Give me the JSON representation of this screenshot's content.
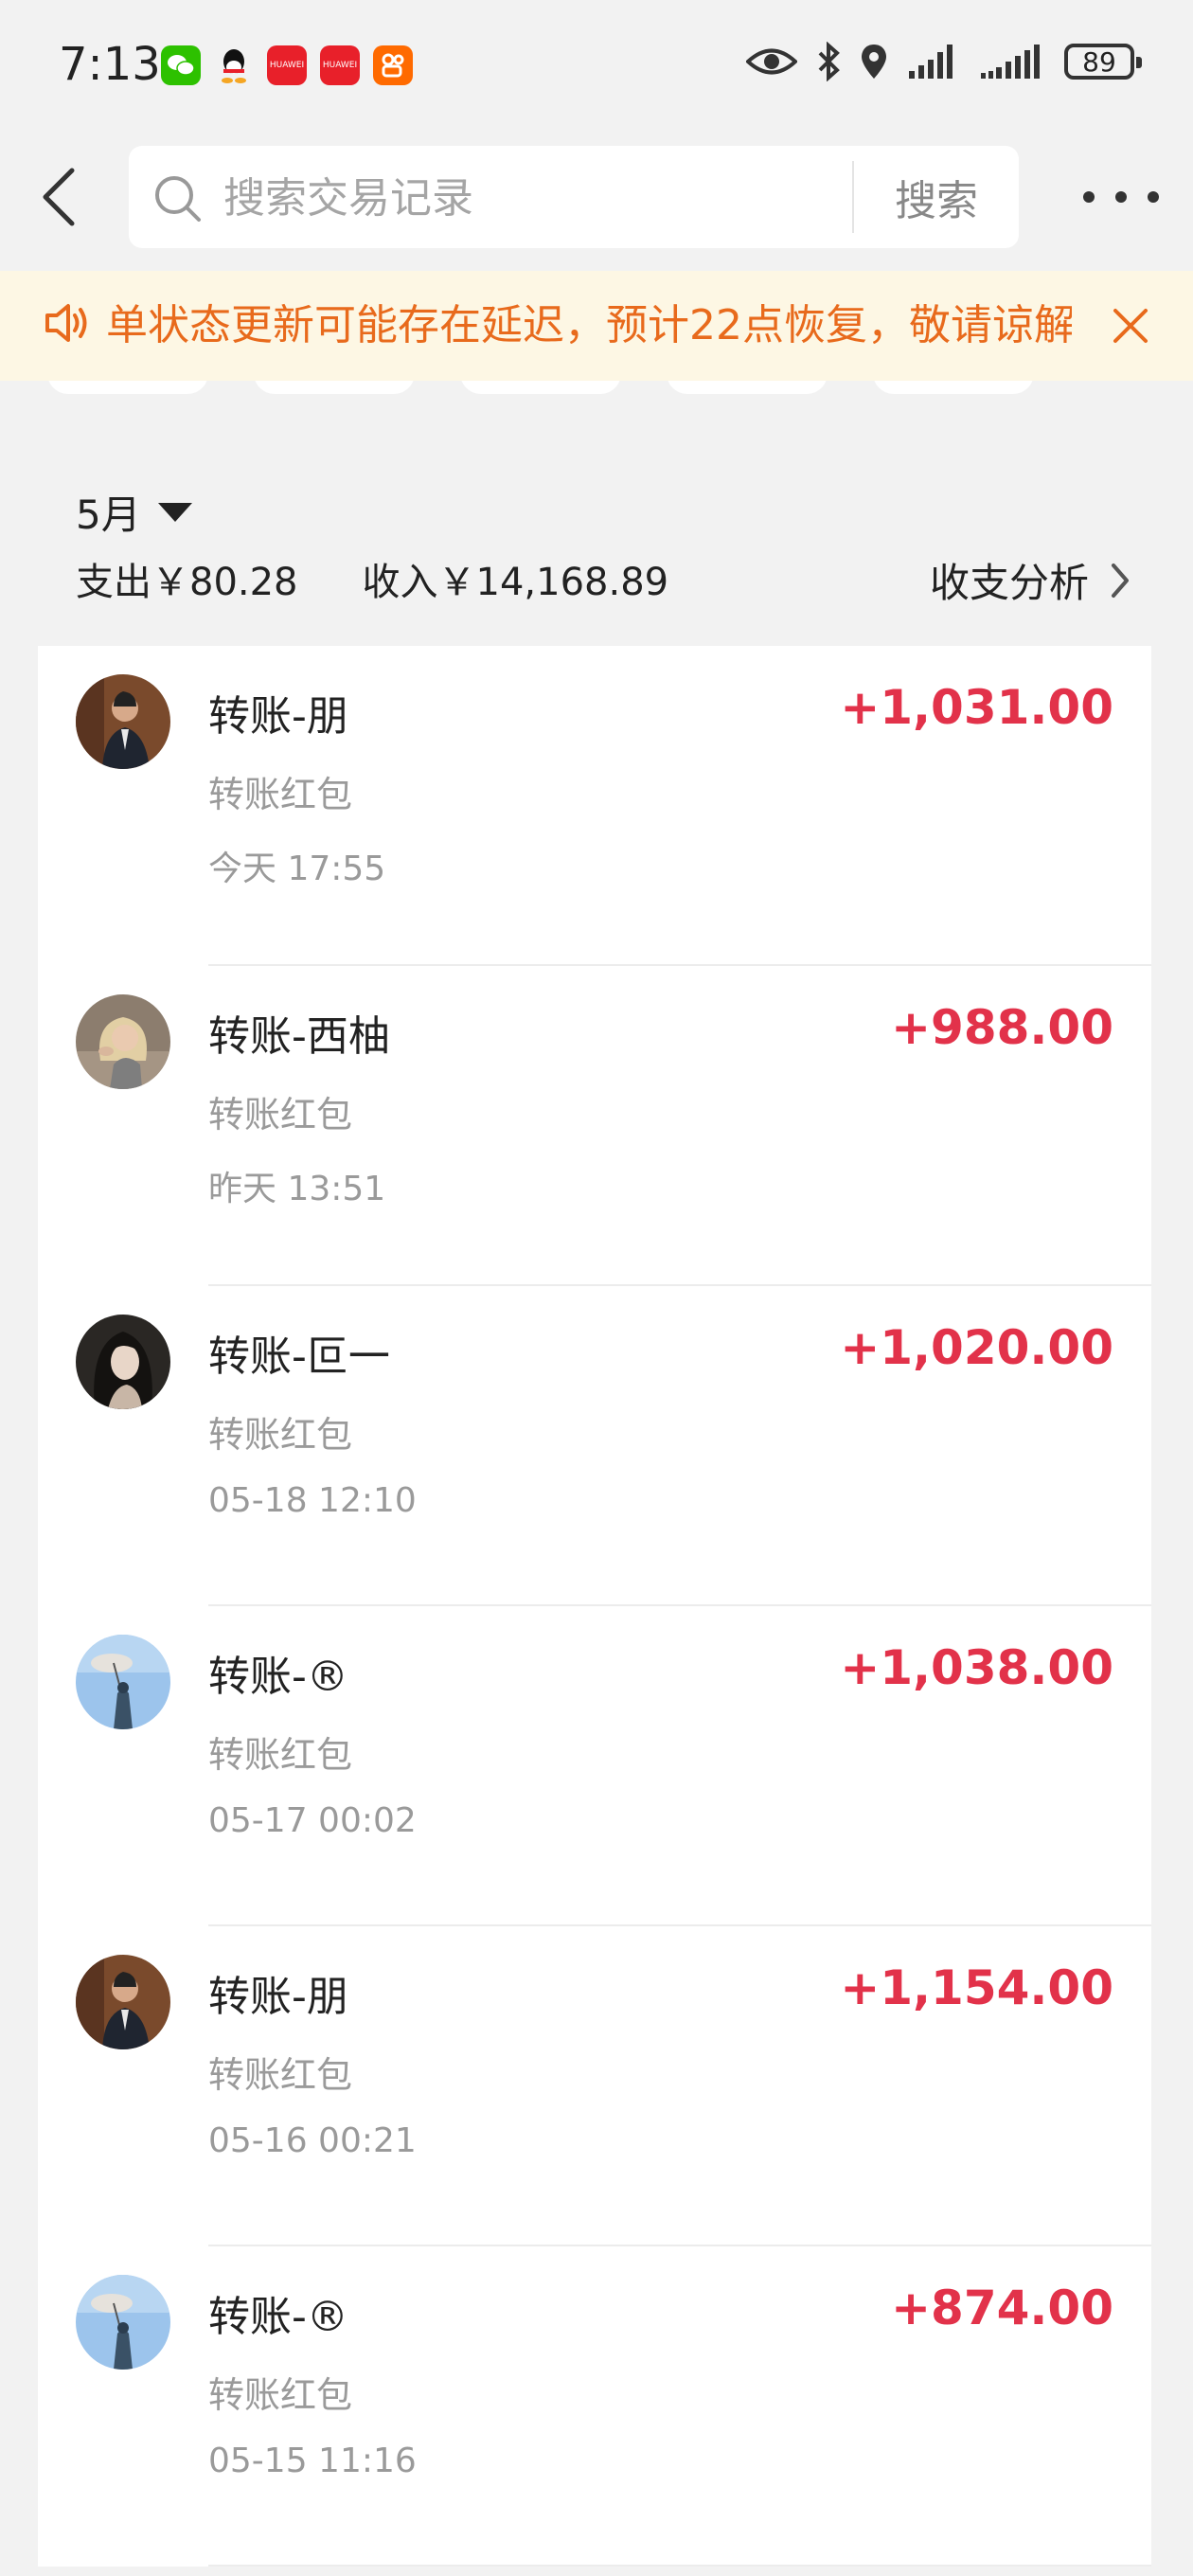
{
  "status_bar": {
    "time": "7:13",
    "battery": "89",
    "app_icons": [
      "wechat-icon",
      "qq-icon",
      "huawei-icon",
      "huawei-icon",
      "kuaishou-icon"
    ],
    "app_icon_labels": {
      "huawei": "HUAWEI"
    },
    "right_icons": [
      "eye-icon",
      "bluetooth-icon",
      "location-icon",
      "signal-icon",
      "signal-icon"
    ]
  },
  "header": {
    "search_placeholder": "搜索交易记录",
    "search_button": "搜索"
  },
  "notice": {
    "text": "单状态更新可能存在延迟，预计22点恢复，敬请谅解"
  },
  "summary": {
    "month": "5月",
    "expense": "支出￥80.28",
    "income": "收入￥14,168.89",
    "analysis_label": "收支分析"
  },
  "transactions": [
    {
      "title": "转账-朋",
      "subtitle": "转账红包",
      "time": "今天 17:55",
      "amount": "+1,031.00",
      "avatar": "avatar-man-suit"
    },
    {
      "title": "转账-西柚",
      "subtitle": "转账红包",
      "time": "昨天 13:51",
      "amount": "+988.00",
      "avatar": "avatar-woman-blonde"
    },
    {
      "title": "转账-叵一",
      "subtitle": "转账红包",
      "time": "05-18 12:10",
      "amount": "+1,020.00",
      "avatar": "avatar-woman-dark"
    },
    {
      "title": "转账-®",
      "subtitle": "转账红包",
      "time": "05-17 00:02",
      "amount": "+1,038.00",
      "avatar": "avatar-sky-figure"
    },
    {
      "title": "转账-朋",
      "subtitle": "转账红包",
      "time": "05-16 00:21",
      "amount": "+1,154.00",
      "avatar": "avatar-man-suit"
    },
    {
      "title": "转账-®",
      "subtitle": "转账红包",
      "time": "05-15 11:16",
      "amount": "+874.00",
      "avatar": "avatar-sky-figure"
    }
  ],
  "colors": {
    "amount": "#e2324a",
    "notice_text": "#e86a1c",
    "notice_bg": "#fdf7e4",
    "page_bg": "#f2f2f2"
  }
}
